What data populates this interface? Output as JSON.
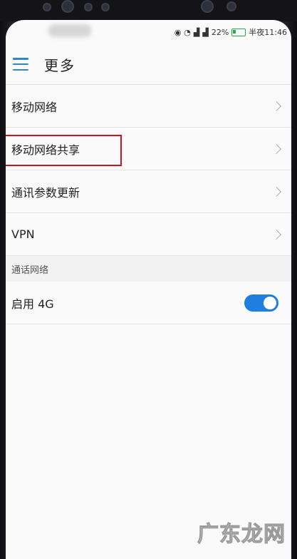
{
  "status_bar": {
    "battery": "22%",
    "time": "半夜11:46"
  },
  "app_bar": {
    "title": "更多"
  },
  "list": {
    "items": [
      {
        "label": "移动网络"
      },
      {
        "label": "移动网络共享"
      },
      {
        "label": "通讯参数更新"
      },
      {
        "label": "VPN"
      }
    ]
  },
  "section": {
    "header": "通话网络",
    "toggle_label": "启用 4G",
    "toggle_on": true
  },
  "watermark": "广东龙网",
  "colors": {
    "accent": "#1f7fe0",
    "highlight": "#c8151e",
    "battery": "#27a64a"
  }
}
